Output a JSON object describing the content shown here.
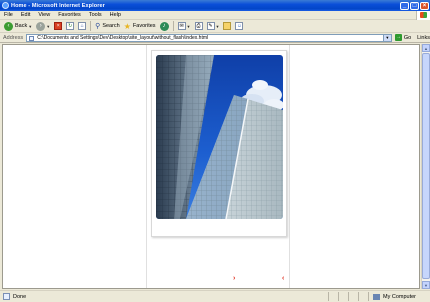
{
  "window": {
    "title": "Home - Microsoft Internet Explorer",
    "controls": [
      "minimize",
      "maximize",
      "close"
    ]
  },
  "menu": [
    "File",
    "Edit",
    "View",
    "Favorites",
    "Tools",
    "Help"
  ],
  "toolbar": {
    "back_label": "Back",
    "search_label": "Search",
    "favorites_label": "Favorites"
  },
  "address": {
    "label": "Address",
    "value": "C:\\Documents and Settings\\Dev\\Desktop\\site_layout\\without_flash\\index.html",
    "go_label": "Go",
    "links_label": "Links"
  },
  "page": {
    "arrow_left": "›",
    "arrow_right": "‹"
  },
  "status": {
    "text": "Done",
    "zone": "My Computer"
  },
  "colors": {
    "titlebar": "#0a4ed8",
    "chrome": "#ece9d8",
    "sky": "#1c57c8",
    "accent_arrow": "#e03020"
  }
}
